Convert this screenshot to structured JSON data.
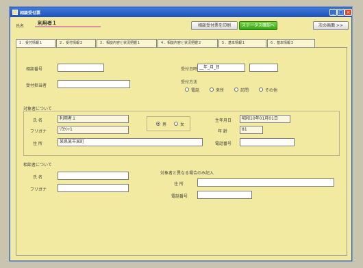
{
  "window": {
    "title": "相談受付票"
  },
  "header": {
    "name_label": "氏名",
    "name_value": "利用者１",
    "buttons": [
      {
        "label": "相談受付票を印刷"
      },
      {
        "label": "ステータス確認へ"
      },
      {
        "label": "次の画面 >>"
      }
    ]
  },
  "tabs": [
    {
      "label": "１．受付情報１",
      "active": true
    },
    {
      "label": "２．受付情報２",
      "active": false
    },
    {
      "label": "３．相談内容と状況把握１",
      "active": false
    },
    {
      "label": "４．相談内容と状況把握２",
      "active": false
    },
    {
      "label": "５．基本情報１",
      "active": false
    },
    {
      "label": "６．基本情報２",
      "active": false
    }
  ],
  "form": {
    "reception_no_label": "相談番号",
    "reception_no_value": "",
    "reception_person_label": "受付担当者",
    "reception_person_value": "",
    "reception_date_label": "受付日時",
    "reception_date_value": "__年_月_日",
    "reception_time_value": "",
    "reception_method_label": "受付方法",
    "reception_methods": [
      {
        "label": "電話",
        "selected": false
      },
      {
        "label": "来所",
        "selected": false
      },
      {
        "label": "訪問",
        "selected": false
      },
      {
        "label": "その他",
        "selected": false
      }
    ],
    "subject_section_label": "対象者について",
    "name_label": "氏 名",
    "name_value": "利用者１",
    "kana_label": "フリガナ",
    "kana_value": "ﾘﾖｳｼｬ1",
    "gender_options": [
      {
        "label": "男",
        "selected": true
      },
      {
        "label": "女",
        "selected": false
      }
    ],
    "birth_label": "生年月日",
    "birth_value": "昭和10年01月01日",
    "age_label": "年 齢",
    "age_value": "81",
    "address_label": "住 所",
    "address_value": "某県某市某町",
    "phone_label": "電話番号",
    "phone_value": "",
    "consultant_section_label": "相談者について",
    "c_name_label": "氏 名",
    "c_name_value": "",
    "c_kana_label": "フリガナ",
    "c_kana_value": "",
    "other_address_section_label": "対象者と異なる場合のみ記入",
    "c_address_label": "住 所",
    "c_address_value": "",
    "c_phone_label": "電話番号",
    "c_phone_value": ""
  },
  "colors": {
    "window_bg": "#f3eaa1",
    "title_bar": "#2a62c8",
    "accent_green": "#4ab81f"
  }
}
